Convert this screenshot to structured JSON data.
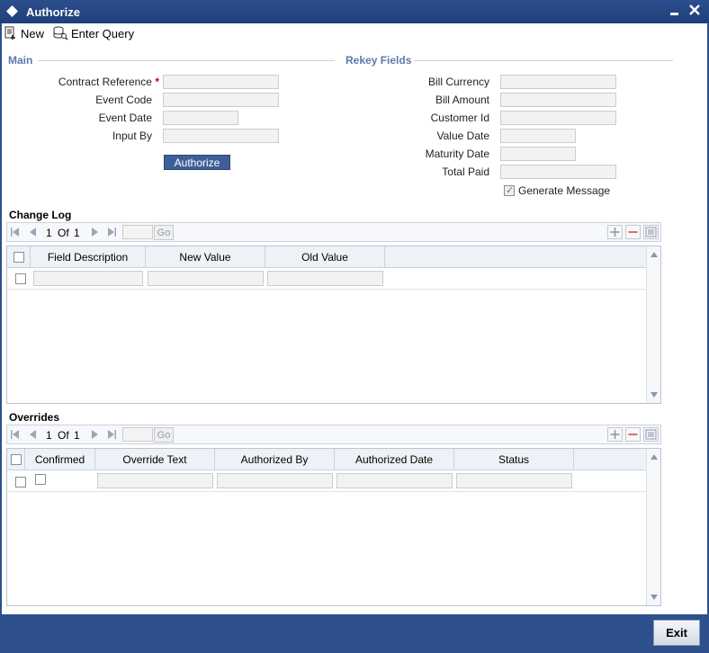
{
  "window": {
    "title": "Authorize"
  },
  "toolbar": {
    "new_label": "New",
    "enter_query_label": "Enter Query"
  },
  "main": {
    "heading": "Main",
    "fields": {
      "contract_reference": {
        "label": "Contract Reference",
        "required": "*",
        "value": ""
      },
      "event_code": {
        "label": "Event Code",
        "value": ""
      },
      "event_date": {
        "label": "Event Date",
        "value": ""
      },
      "input_by": {
        "label": "Input By",
        "value": ""
      }
    },
    "authorize_button": "Authorize"
  },
  "rekey": {
    "heading": "Rekey Fields",
    "fields": {
      "bill_currency": {
        "label": "Bill Currency",
        "value": ""
      },
      "bill_amount": {
        "label": "Bill Amount",
        "value": ""
      },
      "customer_id": {
        "label": "Customer Id",
        "value": ""
      },
      "value_date": {
        "label": "Value Date",
        "value": ""
      },
      "maturity_date": {
        "label": "Maturity Date",
        "value": ""
      },
      "total_paid": {
        "label": "Total Paid",
        "value": ""
      }
    },
    "generate_message": {
      "label": "Generate Message",
      "checked": true
    }
  },
  "change_log": {
    "title": "Change Log",
    "pager": {
      "current": "1",
      "of_label": "Of",
      "total": "1",
      "go_label": "Go"
    },
    "columns": [
      "Field Description",
      "New Value",
      "Old Value"
    ]
  },
  "overrides": {
    "title": "Overrides",
    "pager": {
      "current": "1",
      "of_label": "Of",
      "total": "1",
      "go_label": "Go"
    },
    "columns": [
      "Confirmed",
      "Override Text",
      "Authorized By",
      "Authorized Date",
      "Status"
    ]
  },
  "footer": {
    "exit_label": "Exit"
  },
  "colors": {
    "frame": "#2d4f8c",
    "section_heading": "#5e7aa8",
    "button": "#3f5f98"
  }
}
